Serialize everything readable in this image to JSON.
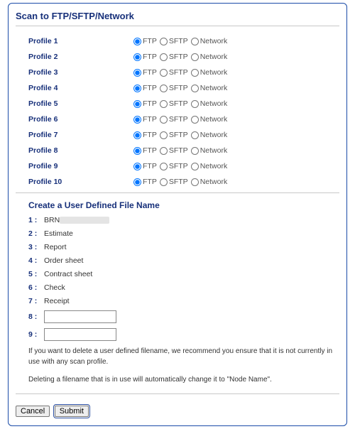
{
  "page_title": "Scan to FTP/SFTP/Network",
  "radio_options": [
    "FTP",
    "SFTP",
    "Network"
  ],
  "profiles": [
    {
      "label": "Profile 1",
      "selected": "FTP"
    },
    {
      "label": "Profile 2",
      "selected": "FTP"
    },
    {
      "label": "Profile 3",
      "selected": "FTP"
    },
    {
      "label": "Profile 4",
      "selected": "FTP"
    },
    {
      "label": "Profile 5",
      "selected": "FTP"
    },
    {
      "label": "Profile 6",
      "selected": "FTP"
    },
    {
      "label": "Profile 7",
      "selected": "FTP"
    },
    {
      "label": "Profile 8",
      "selected": "FTP"
    },
    {
      "label": "Profile 9",
      "selected": "FTP"
    },
    {
      "label": "Profile 10",
      "selected": "FTP"
    }
  ],
  "filenames_title": "Create a User Defined File Name",
  "filenames": [
    {
      "index": "1 :",
      "value": "BRN",
      "redacted": true
    },
    {
      "index": "2 :",
      "value": "Estimate"
    },
    {
      "index": "3 :",
      "value": "Report"
    },
    {
      "index": "4 :",
      "value": "Order sheet"
    },
    {
      "index": "5 :",
      "value": "Contract sheet"
    },
    {
      "index": "6 :",
      "value": "Check"
    },
    {
      "index": "7 :",
      "value": "Receipt"
    },
    {
      "index": "8 :",
      "value": "",
      "editable": true
    },
    {
      "index": "9 :",
      "value": "",
      "editable": true
    }
  ],
  "note1": "If you want to delete a user defined filename, we recommend you ensure that it is not currently in use with any scan profile.",
  "note2": "Deleting a filename that is in use will automatically change it to \"Node Name\".",
  "buttons": {
    "cancel": "Cancel",
    "submit": "Submit"
  }
}
